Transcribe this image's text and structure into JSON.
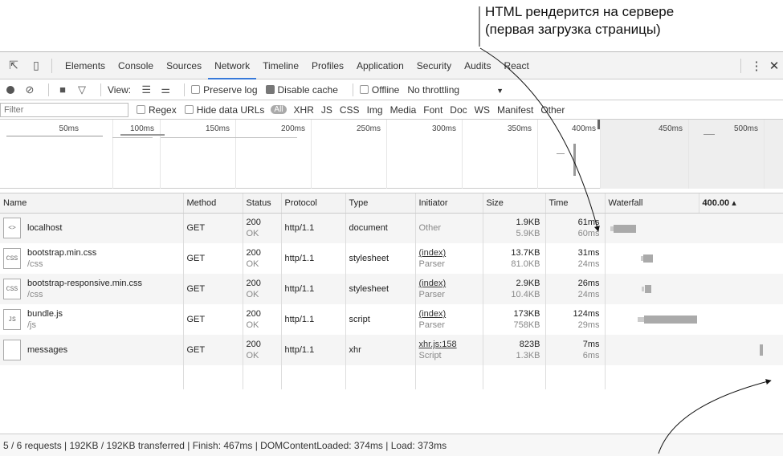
{
  "annotation": {
    "line1": "HTML рендерится на сервере",
    "line2": "(первая загрузка страницы)"
  },
  "tabs": [
    "Elements",
    "Console",
    "Sources",
    "Network",
    "Timeline",
    "Profiles",
    "Application",
    "Security",
    "Audits",
    "React"
  ],
  "active_tab": "Network",
  "toolbar": {
    "view_label": "View:",
    "preserve_log": "Preserve log",
    "disable_cache": "Disable cache",
    "offline": "Offline",
    "throttling": "No throttling"
  },
  "filterbar": {
    "placeholder": "Filter",
    "regex": "Regex",
    "hide_data_urls": "Hide data URLs",
    "all": "All",
    "types": [
      "XHR",
      "JS",
      "CSS",
      "Img",
      "Media",
      "Font",
      "Doc",
      "WS",
      "Manifest",
      "Other"
    ]
  },
  "overview_ticks": [
    "50ms",
    "100ms",
    "150ms",
    "200ms",
    "250ms",
    "300ms",
    "350ms",
    "400ms",
    "450ms",
    "500ms"
  ],
  "columns": {
    "name": "Name",
    "method": "Method",
    "status": "Status",
    "protocol": "Protocol",
    "type": "Type",
    "initiator": "Initiator",
    "size": "Size",
    "time": "Time",
    "waterfall": "Waterfall",
    "waterfall_value": "400.00"
  },
  "requests": [
    {
      "name": "localhost",
      "path": "",
      "icon": "<>",
      "method": "GET",
      "status": "200",
      "status_text": "OK",
      "protocol": "http/1.1",
      "type": "document",
      "initiator": "Other",
      "initiator_sub": "",
      "size": "1.9KB",
      "size_sub": "5.9KB",
      "time": "61ms",
      "time_sub": "60ms"
    },
    {
      "name": "bootstrap.min.css",
      "path": "/css",
      "icon": "CSS",
      "method": "GET",
      "status": "200",
      "status_text": "OK",
      "protocol": "http/1.1",
      "type": "stylesheet",
      "initiator": "(index)",
      "initiator_sub": "Parser",
      "size": "13.7KB",
      "size_sub": "81.0KB",
      "time": "31ms",
      "time_sub": "24ms"
    },
    {
      "name": "bootstrap-responsive.min.css",
      "path": "/css",
      "icon": "CSS",
      "method": "GET",
      "status": "200",
      "status_text": "OK",
      "protocol": "http/1.1",
      "type": "stylesheet",
      "initiator": "(index)",
      "initiator_sub": "Parser",
      "size": "2.9KB",
      "size_sub": "10.4KB",
      "time": "26ms",
      "time_sub": "24ms"
    },
    {
      "name": "bundle.js",
      "path": "/js",
      "icon": "JS",
      "method": "GET",
      "status": "200",
      "status_text": "OK",
      "protocol": "http/1.1",
      "type": "script",
      "initiator": "(index)",
      "initiator_sub": "Parser",
      "size": "173KB",
      "size_sub": "758KB",
      "time": "124ms",
      "time_sub": "29ms"
    },
    {
      "name": "messages",
      "path": "",
      "icon": "",
      "method": "GET",
      "status": "200",
      "status_text": "OK",
      "protocol": "http/1.1",
      "type": "xhr",
      "initiator": "xhr.js:158",
      "initiator_sub": "Script",
      "size": "823B",
      "size_sub": "1.3KB",
      "time": "7ms",
      "time_sub": "6ms"
    }
  ],
  "statusbar": "5 / 6 requests | 192KB / 192KB transferred | Finish: 467ms | DOMContentLoaded: 374ms | Load: 373ms"
}
